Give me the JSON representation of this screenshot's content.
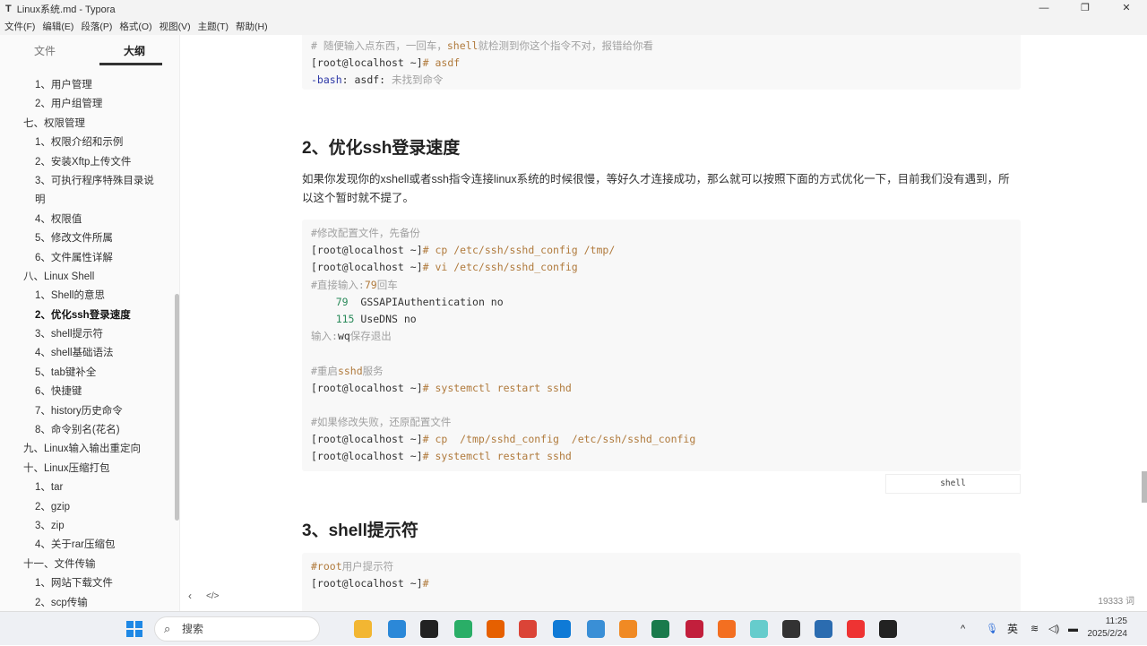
{
  "window": {
    "title": "Linux系统.md - Typora",
    "icon": "T",
    "min": "—",
    "max": "❐",
    "close": "✕"
  },
  "menu": [
    "文件(F)",
    "编辑(E)",
    "段落(P)",
    "格式(O)",
    "视图(V)",
    "主题(T)",
    "帮助(H)"
  ],
  "sidebar": {
    "tabs": [
      "文件",
      "大纲"
    ],
    "outline": [
      {
        "label": "1、用户管理",
        "level": 2
      },
      {
        "label": "2、用户组管理",
        "level": 2
      },
      {
        "label": "七、权限管理",
        "level": 1
      },
      {
        "label": "1、权限介绍和示例",
        "level": 2
      },
      {
        "label": "2、安装Xftp上传文件",
        "level": 2
      },
      {
        "label": "3、可执行程序特殊目录说",
        "level": 2
      },
      {
        "label": "明",
        "level": 2
      },
      {
        "label": "4、权限值",
        "level": 2
      },
      {
        "label": "5、修改文件所属",
        "level": 2
      },
      {
        "label": "6、文件属性详解",
        "level": 2
      },
      {
        "label": "八、Linux Shell",
        "level": 1
      },
      {
        "label": "1、Shell的意思",
        "level": 2
      },
      {
        "label": "2、优化ssh登录速度",
        "level": 2,
        "active": true
      },
      {
        "label": "3、shell提示符",
        "level": 2
      },
      {
        "label": "4、shell基础语法",
        "level": 2
      },
      {
        "label": "5、tab键补全",
        "level": 2
      },
      {
        "label": "6、快捷键",
        "level": 2
      },
      {
        "label": "7、history历史命令",
        "level": 2
      },
      {
        "label": "8、命令别名(花名)",
        "level": 2
      },
      {
        "label": "九、Linux输入输出重定向",
        "level": 1
      },
      {
        "label": "十、Linux压缩打包",
        "level": 1
      },
      {
        "label": "1、tar",
        "level": 2
      },
      {
        "label": "2、gzip",
        "level": 2
      },
      {
        "label": "3、zip",
        "level": 2
      },
      {
        "label": "4、关于rar压缩包",
        "level": 2
      },
      {
        "label": "十一、文件传输",
        "level": 1
      },
      {
        "label": "1、网站下载文件",
        "level": 2
      },
      {
        "label": "2、scp传输",
        "level": 2
      }
    ],
    "footer": {
      "back": "‹",
      "source": "</>"
    }
  },
  "code1": [
    [
      [
        "# 随便输入点东西，一回车，",
        "c"
      ],
      [
        "shell",
        "k"
      ],
      [
        "就检测到你这个指令不对，报错给你看",
        "c"
      ]
    ],
    [
      [
        "[root@localhost ~]",
        "p"
      ],
      [
        "# asdf",
        "k"
      ]
    ],
    [
      [
        "-bash",
        "b"
      ],
      [
        ": asdf: ",
        "p"
      ],
      [
        "未找到命令",
        "c"
      ]
    ]
  ],
  "h2_1": "2、优化ssh登录速度",
  "para1": "如果你发现你的xshell或者ssh指令连接linux系统的时候很慢，等好久才连接成功，那么就可以按照下面的方式优化一下，目前我们没有遇到，所以这个暂时就不提了。",
  "code2": [
    [
      [
        "#修改配置文件，先备份",
        "c"
      ]
    ],
    [
      [
        "[root@localhost ~]",
        "p"
      ],
      [
        "# cp /etc/ssh/sshd_config /tmp/",
        "k"
      ]
    ],
    [
      [
        "[root@localhost ~]",
        "p"
      ],
      [
        "# vi /etc/ssh/sshd_config",
        "k"
      ]
    ],
    [
      [
        "#直接输入:",
        "c"
      ],
      [
        "79",
        "k"
      ],
      [
        "回车",
        "c"
      ]
    ],
    [
      [
        "    79",
        "n"
      ],
      [
        "  GSSAPIAuthentication no",
        "p"
      ]
    ],
    [
      [
        "    115",
        "n"
      ],
      [
        " UseDNS no",
        "p"
      ]
    ],
    [
      [
        "输入:",
        "c"
      ],
      [
        "wq",
        "p"
      ],
      [
        "保存退出",
        "c"
      ]
    ],
    [
      [
        "",
        "p"
      ]
    ],
    [
      [
        "#重启",
        "c"
      ],
      [
        "sshd",
        "k"
      ],
      [
        "服务",
        "c"
      ]
    ],
    [
      [
        "[root@localhost ~]",
        "p"
      ],
      [
        "# systemctl restart sshd",
        "k"
      ]
    ],
    [
      [
        "",
        "p"
      ]
    ],
    [
      [
        "#如果修改失败，还原配置文件",
        "c"
      ]
    ],
    [
      [
        "[root@localhost ~]",
        "p"
      ],
      [
        "# cp  /tmp/sshd_config  /etc/ssh/sshd_config",
        "k"
      ]
    ],
    [
      [
        "[root@localhost ~]",
        "p"
      ],
      [
        "# systemctl restart sshd",
        "k"
      ]
    ]
  ],
  "code2_lang": "shell",
  "h2_2": "3、shell提示符",
  "code3": [
    [
      [
        "#root",
        "k"
      ],
      [
        "用户提示符",
        "c"
      ]
    ],
    [
      [
        "[root@localhost ~]",
        "p"
      ],
      [
        "#",
        "k"
      ]
    ]
  ],
  "word_count": "19333 词",
  "taskbar": {
    "search": "搜索",
    "ime": "英",
    "time": "11:25",
    "date": "2025/2/24",
    "icons": [
      "file-explorer",
      "store",
      "qq",
      "wechat",
      "firefox",
      "chrome",
      "edge",
      "sync",
      "app",
      "terminal",
      "jetbrains",
      "pen",
      "game",
      "unity",
      "vmware",
      "mail",
      "typora"
    ],
    "colors": [
      "#f2b632",
      "#2b88d8",
      "#222",
      "#2aae67",
      "#e66000",
      "#db4437",
      "#0f7ad6",
      "#3a8fd6",
      "#f08a24",
      "#1a7a4c",
      "#c21f3c",
      "#f36f21",
      "#6cc",
      "#333",
      "#2b6cb0",
      "#e33",
      "#222"
    ]
  }
}
